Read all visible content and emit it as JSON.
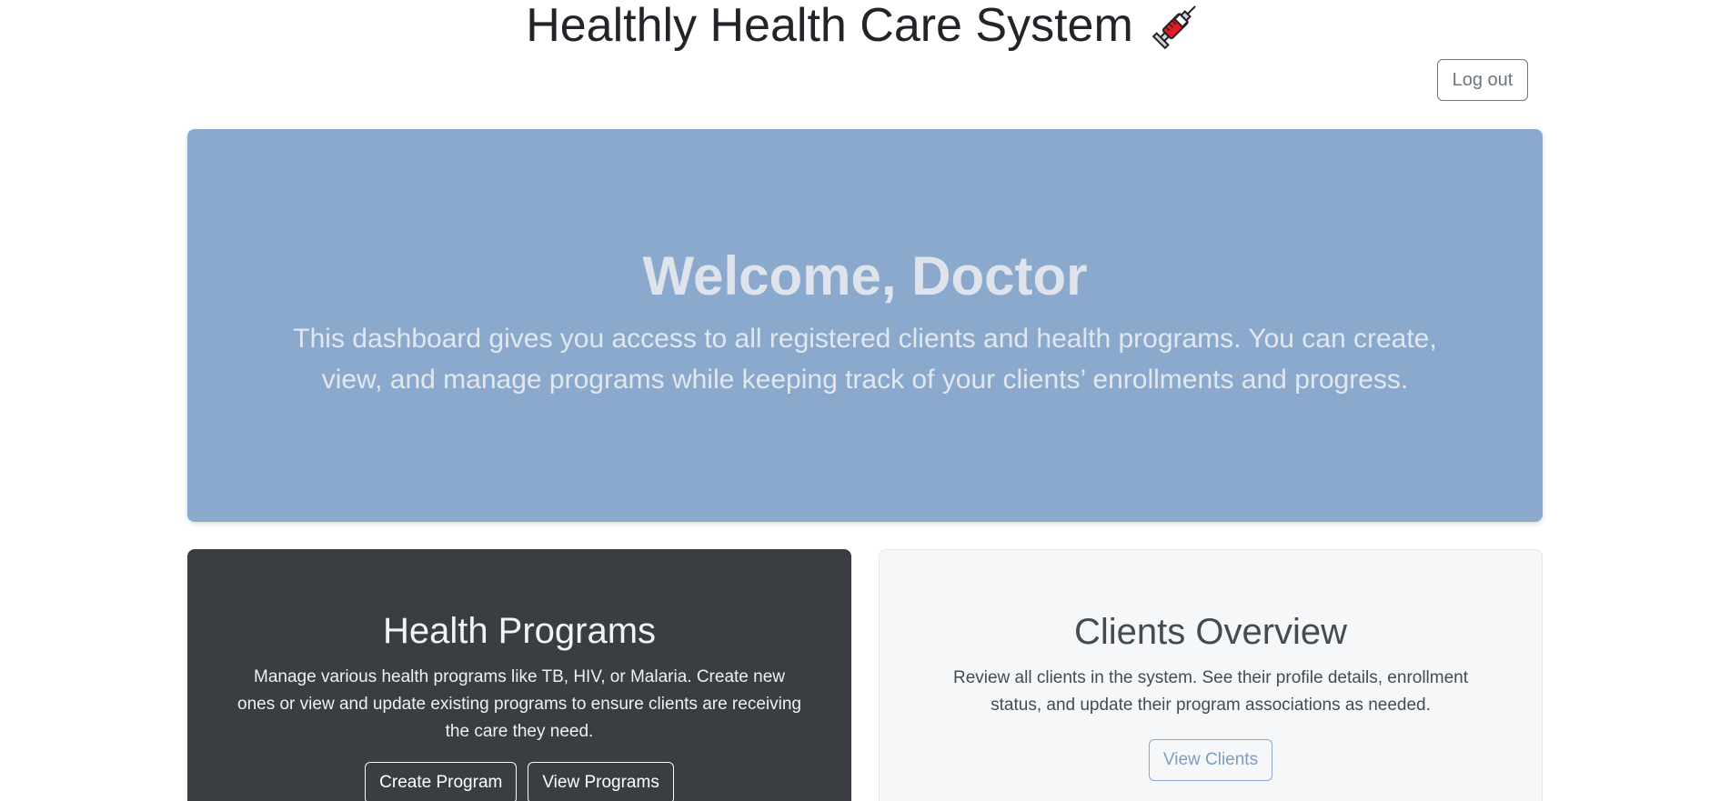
{
  "header": {
    "title": "Healthly Health Care System",
    "title_icon": "syringe-icon",
    "logout_label": "Log out"
  },
  "hero": {
    "heading": "Welcome, Doctor",
    "text": "This dashboard gives you access to all registered clients and health programs. You can create, view, and manage programs while keeping track of your clients’ enrollments and progress."
  },
  "cards": {
    "programs": {
      "title": "Health Programs",
      "text": "Manage various health programs like TB, HIV, or Malaria. Create new ones or view and update existing programs to ensure clients are receiving the care they need.",
      "create_label": "Create Program",
      "view_label": "View Programs"
    },
    "clients": {
      "title": "Clients Overview",
      "text": "Review all clients in the system. See their profile details, enrollment status, and update their program associations as needed.",
      "view_label": "View Clients"
    }
  },
  "colors": {
    "hero_background": "#8aa9cc",
    "programs_card_background": "#3a3d42",
    "clients_card_background": "#f6f7f9",
    "accent": "#7d9cc4"
  }
}
